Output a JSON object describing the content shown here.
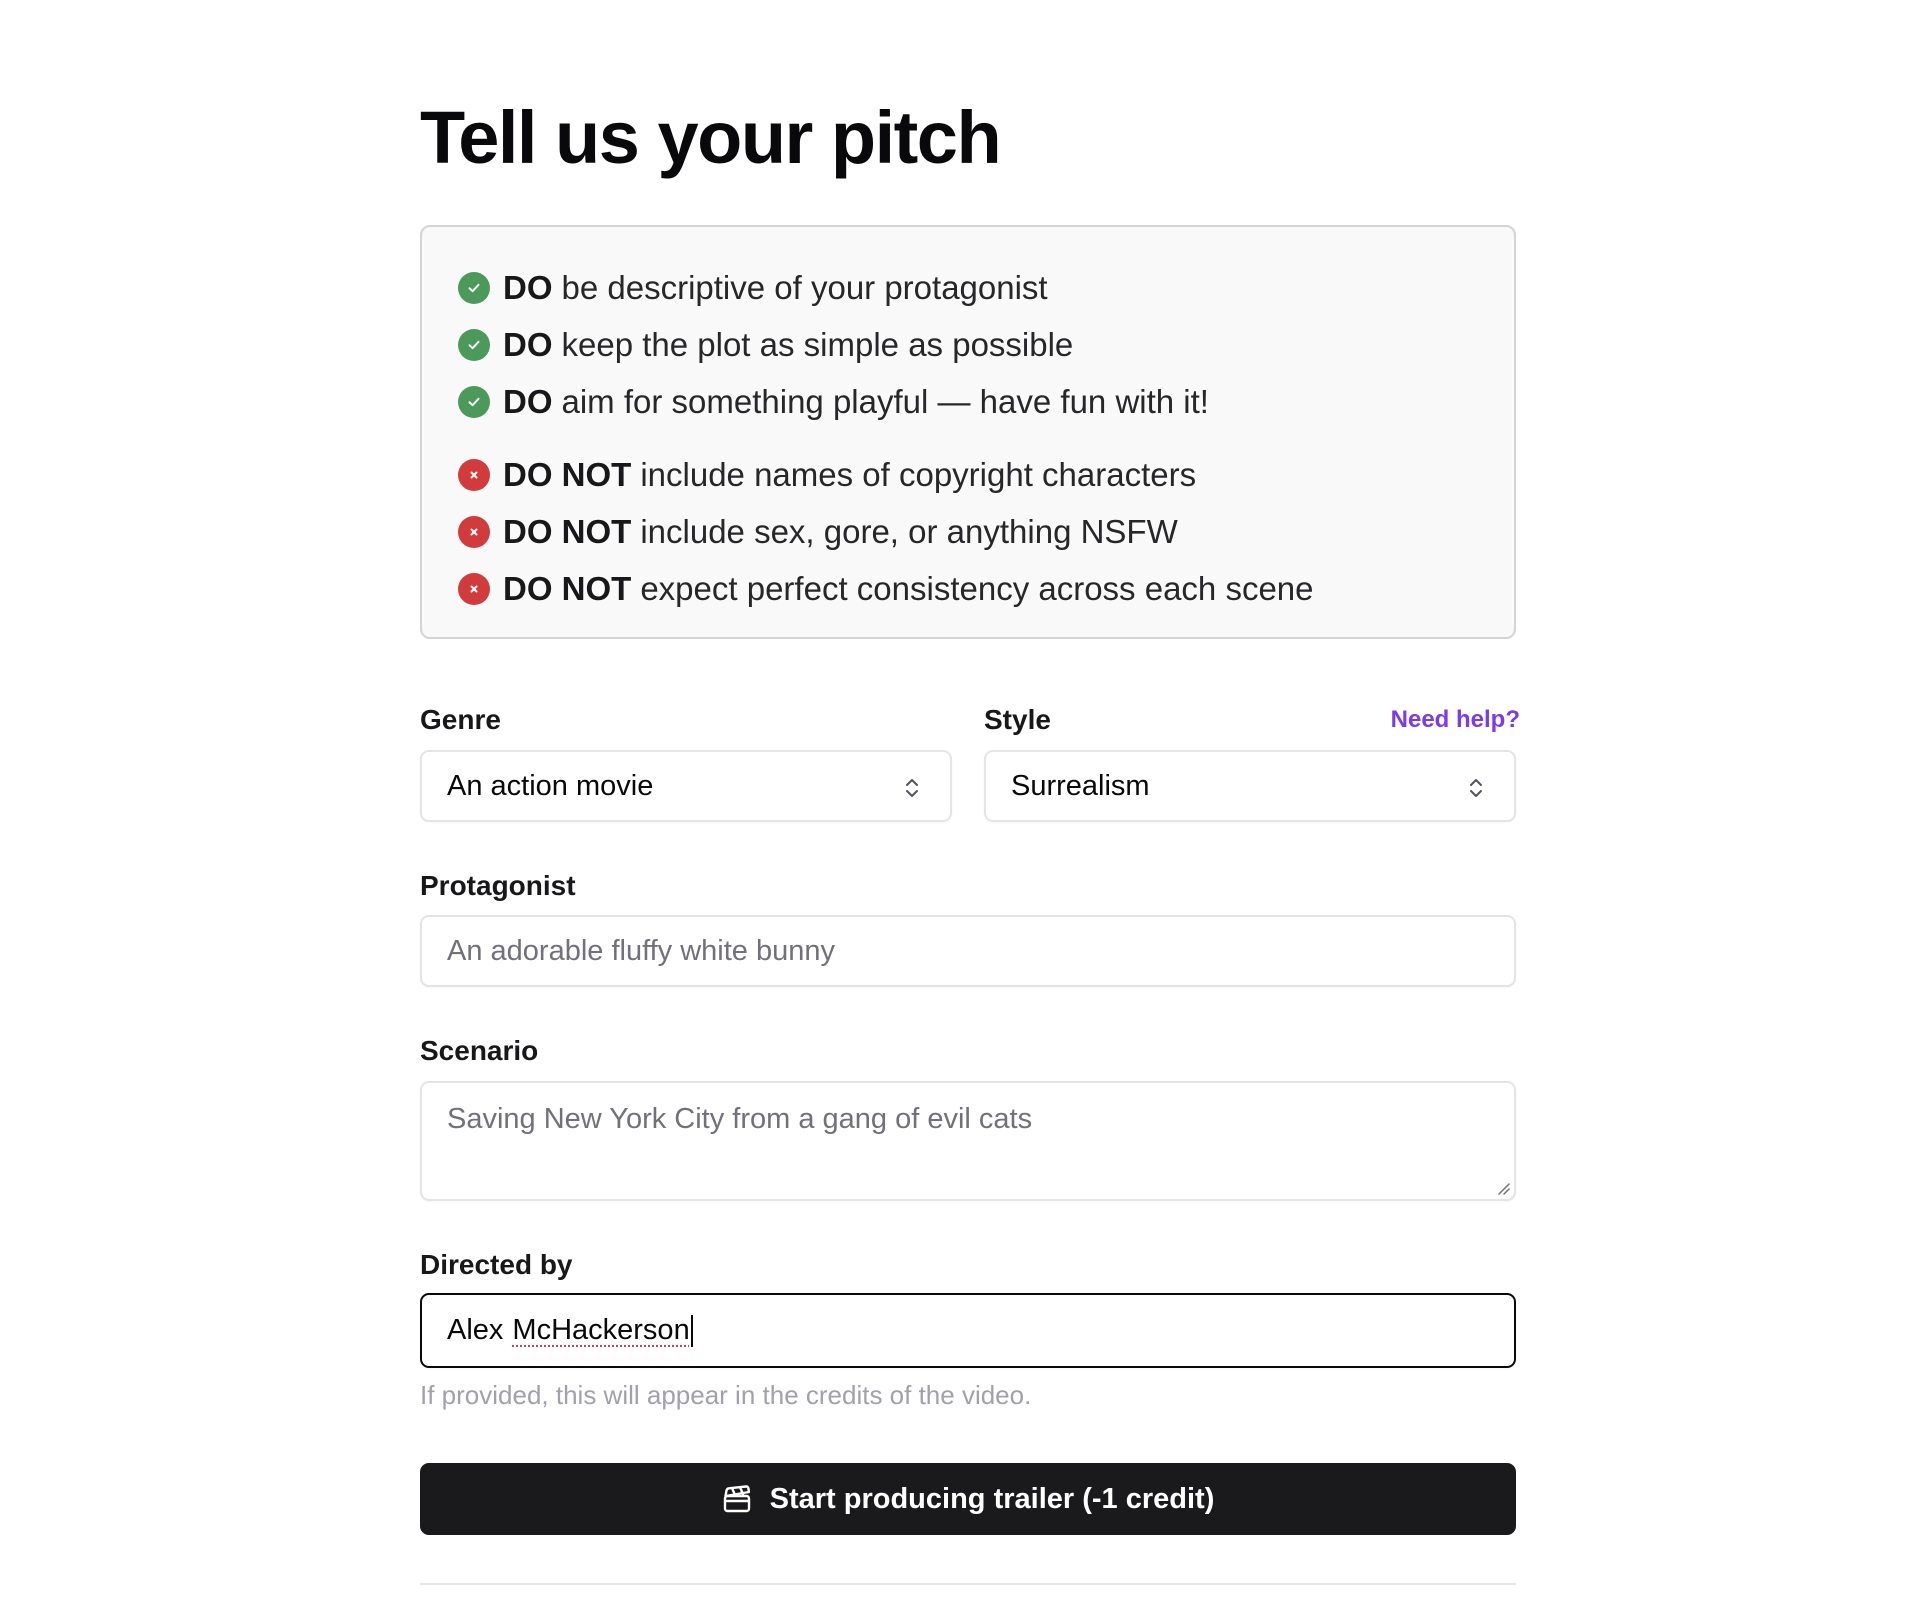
{
  "title": "Tell us your pitch",
  "rules": {
    "do_items": [
      {
        "strong": "DO",
        "text": "be descriptive of your protagonist"
      },
      {
        "strong": "DO",
        "text": "keep the plot as simple as possible"
      },
      {
        "strong": "DO",
        "text": "aim for something playful — have fun with it!"
      }
    ],
    "dont_items": [
      {
        "strong": "DO NOT",
        "text": "include names of copyright characters"
      },
      {
        "strong": "DO NOT",
        "text": "include sex, gore, or anything NSFW"
      },
      {
        "strong": "DO NOT",
        "text": "expect perfect consistency across each scene"
      }
    ]
  },
  "form": {
    "genre": {
      "label": "Genre",
      "value": "An action movie"
    },
    "style": {
      "label": "Style",
      "value": "Surrealism",
      "help_link": "Need help?"
    },
    "protagonist": {
      "label": "Protagonist",
      "placeholder": "An adorable fluffy white bunny"
    },
    "scenario": {
      "label": "Scenario",
      "placeholder": "Saving New York City from a gang of evil cats"
    },
    "directed_by": {
      "label": "Directed by",
      "value_first": "Alex",
      "value_second": "McHackerson",
      "hint": "If provided, this will appear in the credits of the video."
    }
  },
  "submit": {
    "label": "Start producing trailer (-1 credit)",
    "icon": "clapperboard-icon"
  },
  "colors": {
    "do_badge": "#4c9a5a",
    "dont_badge": "#d23b3b",
    "link": "#7c3aed",
    "button_bg": "#1a1a1c"
  }
}
